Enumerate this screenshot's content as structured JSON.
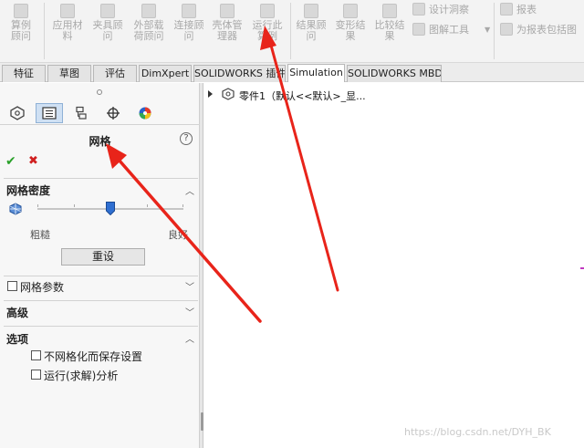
{
  "ribbon": {
    "buttons": [
      {
        "label": "算例顾问",
        "icon": "study-advisor-icon"
      },
      {
        "label": "应用材料",
        "icon": "apply-material-icon"
      },
      {
        "label": "夹具顾问",
        "icon": "fixtures-advisor-icon"
      },
      {
        "label": "外部载荷顾问",
        "icon": "external-loads-advisor-icon"
      },
      {
        "label": "连接顾问",
        "icon": "connections-advisor-icon"
      },
      {
        "label": "壳体管理器",
        "icon": "shell-manager-icon"
      },
      {
        "label": "运行此算例",
        "icon": "run-study-icon"
      },
      {
        "label": "结果顾问",
        "icon": "results-advisor-icon"
      },
      {
        "label": "变形结果",
        "icon": "deformed-result-icon"
      },
      {
        "label": "比较结果",
        "icon": "compare-results-icon"
      }
    ],
    "design_insight": "设计洞察",
    "plot_tools": "图解工具",
    "report": "报表",
    "include_image": "为报表包括图"
  },
  "tabs": [
    {
      "label": "特征",
      "active": false
    },
    {
      "label": "草图",
      "active": false
    },
    {
      "label": "评估",
      "active": false
    },
    {
      "label": "DimXpert",
      "active": false
    },
    {
      "label": "SOLIDWORKS 插件",
      "active": false
    },
    {
      "label": "Simulation",
      "active": true
    },
    {
      "label": "SOLIDWORKS MBD",
      "active": false
    }
  ],
  "panel": {
    "title": "网格",
    "help": "?",
    "ok_glyph": "✔",
    "cancel_glyph": "✖",
    "density": {
      "title": "网格密度",
      "coarse_label": "粗糙",
      "fine_label": "良好",
      "slider_level": 0.5,
      "reset_label": "重设"
    },
    "mesh_params": {
      "label": "网格参数",
      "checked": false
    },
    "advanced": {
      "label": "高级"
    },
    "options": {
      "title": "选项",
      "items": [
        {
          "label": "不网格化而保存设置",
          "checked": false
        },
        {
          "label": "运行(求解)分析",
          "checked": false
        }
      ]
    }
  },
  "tree": {
    "item": "零件1（默认<<默认>_显..."
  },
  "watermark": "https://blog.csdn.net/DYH_BK",
  "colors": {
    "arrow_red": "#e8241a",
    "ok_green": "#2aa12a",
    "cancel_red": "#d02020",
    "selection_blue": "#cfe0f3"
  }
}
